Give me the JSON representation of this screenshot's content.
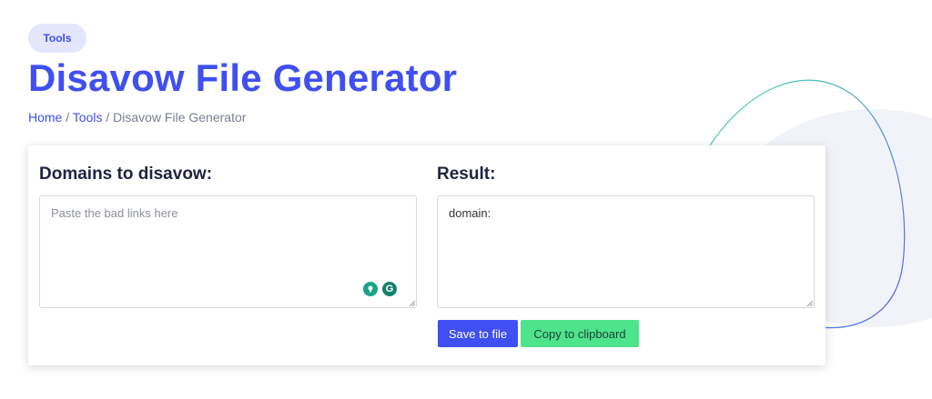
{
  "header": {
    "pill_label": "Tools",
    "title": "Disavow File Generator"
  },
  "breadcrumb": {
    "home": "Home",
    "sep1": " / ",
    "tools": "Tools",
    "sep2": " / ",
    "current": "Disavow File Generator"
  },
  "input_panel": {
    "title": "Domains to disavow:",
    "placeholder": "Paste the bad links here",
    "value": ""
  },
  "result_panel": {
    "title": "Result:",
    "value": "domain:"
  },
  "buttons": {
    "save_label": "Save to file",
    "copy_label": "Copy to clipboard"
  },
  "extension": {
    "g_letter": "G"
  },
  "colors": {
    "accent": "#3f4ff2",
    "copy_button": "#4ee48b",
    "pill_bg": "#e3e6fd"
  }
}
